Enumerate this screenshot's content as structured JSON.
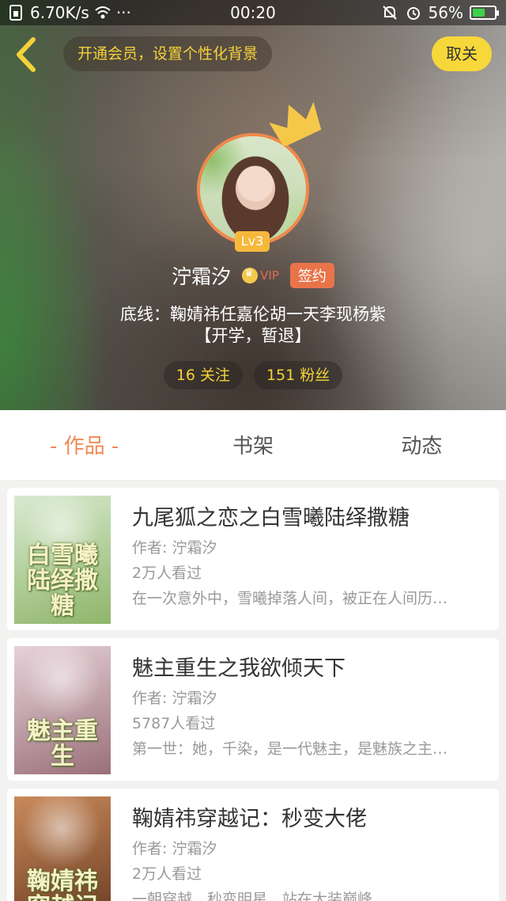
{
  "status_bar": {
    "network_speed": "6.70K/s",
    "more": "···",
    "time": "00:20",
    "battery_percent": "56%",
    "battery_level": 0.56
  },
  "header": {
    "promo_text": "开通会员，设置个性化背景",
    "unfollow_label": "取关",
    "level": "Lv3",
    "username": "泞霜汐",
    "vip_label": "VIP",
    "signed_label": "签约",
    "bio_line1": "底线：鞠婧祎任嘉伦胡一天李现杨紫",
    "bio_line2": "【开学，暂退】",
    "following": "16 关注",
    "followers": "151 粉丝"
  },
  "tabs": [
    {
      "label": "- 作品 -",
      "active": true
    },
    {
      "label": "书架",
      "active": false
    },
    {
      "label": "动态",
      "active": false
    }
  ],
  "works": [
    {
      "title": "九尾狐之恋之白雪曦陆绎撒糖",
      "author": "作者: 泞霜汐",
      "views": "2万人看过",
      "summary": "在一次意外中，雪曦掉落人间，被正在人间历…",
      "cover_text": "白雪曦陆绎撒糖",
      "cover_colors": [
        "#d9ead0",
        "#8fb56a"
      ]
    },
    {
      "title": "魅主重生之我欲倾天下",
      "author": "作者: 泞霜汐",
      "views": "5787人看过",
      "summary": "第一世：她，千染，是一代魅主，是魅族之主…",
      "cover_text": "魅主重生",
      "cover_colors": [
        "#e6d2d8",
        "#9a6f7a"
      ]
    },
    {
      "title": "鞠婧祎穿越记：秒变大佬",
      "author": "作者: 泞霜汐",
      "views": "2万人看过",
      "summary": "一朝穿越，秒变明星，站在大装巅峰",
      "cover_text": "鞠婧祎穿越记",
      "cover_colors": [
        "#c98a5a",
        "#6a3a22"
      ]
    }
  ],
  "colors": {
    "accent": "#ef8a55",
    "gold": "#f5d23a",
    "unfollow_bg": "#f7d83a"
  }
}
